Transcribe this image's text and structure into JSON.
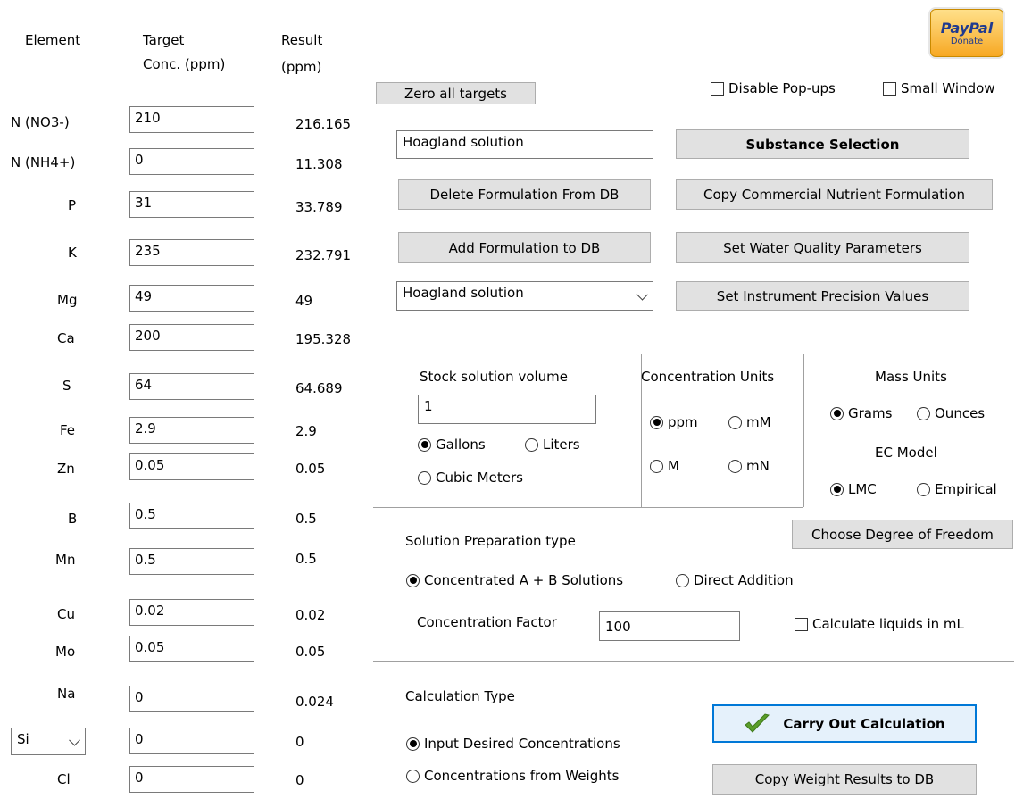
{
  "headers": {
    "element": "Element",
    "target_line1": "Target",
    "target_line2": "Conc. (ppm)",
    "result_line1": "Result",
    "result_line2": "(ppm)"
  },
  "elements": [
    {
      "label": "N (NO3-)",
      "target": "210",
      "result": "216.165"
    },
    {
      "label": "N (NH4+)",
      "target": "0",
      "result": "11.308"
    },
    {
      "label": "P",
      "target": "31",
      "result": "33.789"
    },
    {
      "label": "K",
      "target": "235",
      "result": "232.791"
    },
    {
      "label": "Mg",
      "target": "49",
      "result": "49"
    },
    {
      "label": "Ca",
      "target": "200",
      "result": "195.328"
    },
    {
      "label": "S",
      "target": "64",
      "result": "64.689"
    },
    {
      "label": "Fe",
      "target": "2.9",
      "result": "2.9"
    },
    {
      "label": "Zn",
      "target": "0.05",
      "result": "0.05"
    },
    {
      "label": "B",
      "target": "0.5",
      "result": "0.5"
    },
    {
      "label": "Mn",
      "target": "0.5",
      "result": "0.5"
    },
    {
      "label": "Cu",
      "target": "0.02",
      "result": "0.02"
    },
    {
      "label": "Mo",
      "target": "0.05",
      "result": "0.05"
    },
    {
      "label": "Na",
      "target": "0",
      "result": "0.024"
    },
    {
      "label": "Si",
      "target": "0",
      "result": "0"
    },
    {
      "label": "Cl",
      "target": "0",
      "result": "0"
    }
  ],
  "paypal": {
    "brand": "PayPal",
    "action": "Donate"
  },
  "buttons": {
    "zero_targets": "Zero all targets",
    "substance_selection": "Substance Selection",
    "delete_formulation": "Delete Formulation From DB",
    "copy_commercial": "Copy Commercial Nutrient Formulation",
    "add_formulation": "Add Formulation to DB",
    "water_quality": "Set Water Quality Parameters",
    "instrument_precision": "Set Instrument Precision Values",
    "degree_of_freedom": "Choose Degree of Freedom",
    "carry_out": "Carry Out Calculation",
    "copy_weights": "Copy Weight Results to DB"
  },
  "checkboxes": {
    "disable_popups": "Disable Pop-ups",
    "small_window": "Small Window",
    "liquids_ml": "Calculate liquids in mL"
  },
  "formulation": {
    "name_value": "Hoagland solution",
    "dropdown_value": "Hoagland solution"
  },
  "stock": {
    "label": "Stock solution volume",
    "value": "1",
    "gallons": "Gallons",
    "liters": "Liters",
    "cubic_meters": "Cubic Meters"
  },
  "conc_units": {
    "label": "Concentration Units",
    "ppm": "ppm",
    "mM": "mM",
    "M": "M",
    "mN": "mN"
  },
  "mass_units": {
    "label": "Mass Units",
    "grams": "Grams",
    "ounces": "Ounces"
  },
  "ec_model": {
    "label": "EC Model",
    "lmc": "LMC",
    "empirical": "Empirical"
  },
  "prep": {
    "label": "Solution Preparation type",
    "ab": "Concentrated A + B Solutions",
    "direct": "Direct Addition",
    "factor_label": "Concentration Factor",
    "factor_value": "100"
  },
  "calc_type": {
    "label": "Calculation Type",
    "desired": "Input Desired Concentrations",
    "weights": "Concentrations from  Weights"
  },
  "colors": {
    "button_face": "#e1e1e1",
    "focus_border": "#0078d7",
    "checkmark": "#5a9e2a"
  }
}
